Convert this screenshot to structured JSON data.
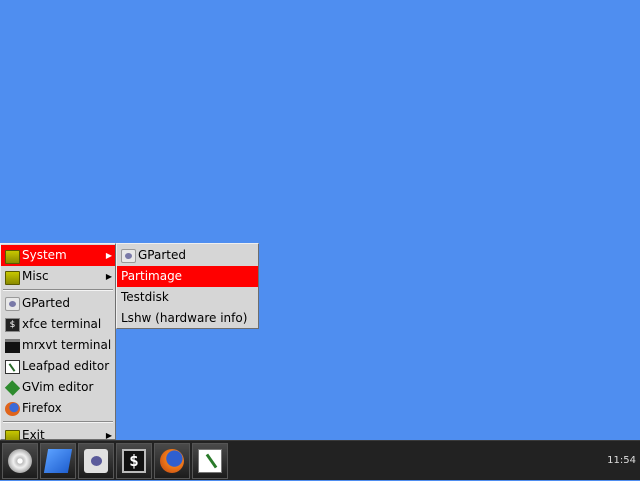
{
  "main_menu": {
    "items": [
      {
        "label": "System",
        "icon": "folder-icon",
        "active": true,
        "submenu": true
      },
      {
        "label": "Misc",
        "icon": "folder-icon",
        "submenu": true
      },
      {
        "label": "GParted",
        "icon": "gparted-icon"
      },
      {
        "label": "xfce terminal",
        "icon": "terminal-icon"
      },
      {
        "label": "mrxvt terminal",
        "icon": "terminal-window-icon"
      },
      {
        "label": "Leafpad editor",
        "icon": "text-editor-icon"
      },
      {
        "label": "GVim editor",
        "icon": "gvim-icon"
      },
      {
        "label": "Firefox",
        "icon": "firefox-icon"
      },
      {
        "label": "Exit",
        "icon": "folder-icon",
        "submenu": true
      }
    ]
  },
  "sub_menu": {
    "items": [
      {
        "label": "GParted",
        "icon": "gparted-icon"
      },
      {
        "label": "Partimage",
        "active": true
      },
      {
        "label": "Testdisk"
      },
      {
        "label": "Lshw (hardware info)"
      }
    ]
  },
  "taskbar": {
    "launchers": [
      "start-menu-cd-icon",
      "document-editor-icon",
      "gparted-icon",
      "terminal-icon",
      "firefox-icon",
      "leafpad-icon"
    ],
    "clock": "11:54"
  },
  "colors": {
    "desktop": "#4f8ef0",
    "highlight": "#ff0000",
    "taskbar": "#222222"
  }
}
